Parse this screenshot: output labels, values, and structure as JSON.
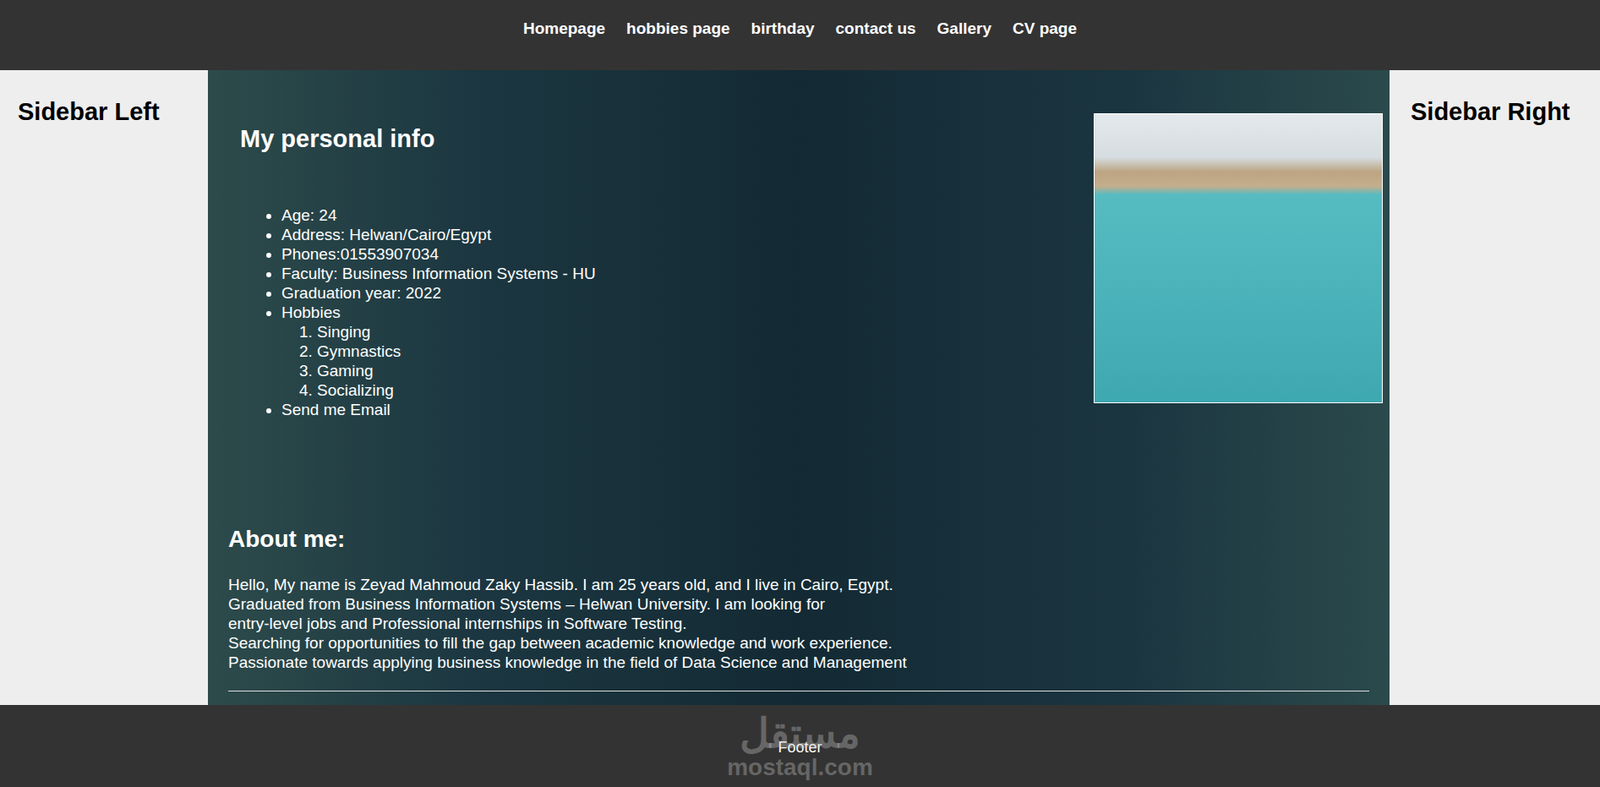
{
  "nav": {
    "links": [
      "Homepage",
      "hobbies page",
      "birthday",
      "contact us",
      "Gallery",
      "CV page"
    ]
  },
  "sidebar_left": {
    "title": "Sidebar Left"
  },
  "sidebar_right": {
    "title": "Sidebar Right"
  },
  "personal_info": {
    "title": "My personal info",
    "items": [
      {
        "text": "Age: 24",
        "sub": []
      },
      {
        "text": "Address: Helwan/Cairo/Egypt",
        "sub": []
      },
      {
        "text": "Phones:01553907034",
        "sub": []
      },
      {
        "text": "Faculty: Business Information Systems - HU",
        "sub": []
      },
      {
        "text": "Graduation year: 2022",
        "sub": []
      },
      {
        "text": "Hobbies",
        "sub": [
          "Singing",
          "Gymnastics",
          "Gaming",
          "Socializing"
        ]
      },
      {
        "text": "Send me Email",
        "sub": []
      }
    ]
  },
  "about": {
    "title": "About me:",
    "lines": [
      "Hello, My name is Zeyad Mahmoud Zaky Hassib. I am 25 years old, and I live in Cairo, Egypt.",
      "Graduated from Business Information Systems – Helwan University. I am looking for",
      "entry-level jobs and Professional internships in Software Testing.",
      "Searching for opportunities to fill the gap between academic knowledge and work experience.",
      "Passionate towards applying business knowledge in the field of Data Science and Management"
    ]
  },
  "footer": {
    "text": "Footer"
  },
  "watermark": {
    "arabic": "مستقل",
    "latin": "mostaql.com"
  }
}
